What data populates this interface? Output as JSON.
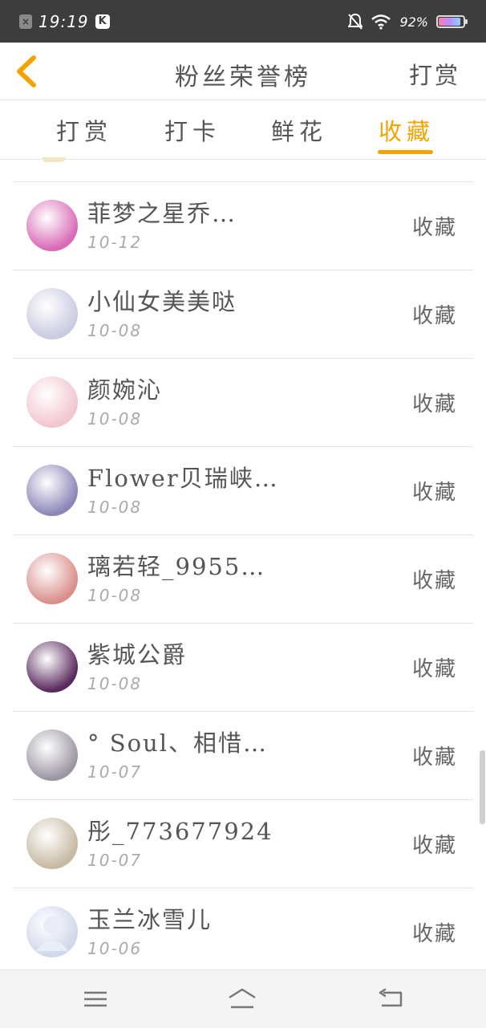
{
  "status_bar": {
    "time": "19:19",
    "battery_percent": "92%",
    "battery_level": 0.92,
    "left_icons": [
      "sim-x-icon",
      "k-app-icon"
    ],
    "right_icons": [
      "mute-icon",
      "wifi-icon",
      "battery-icon"
    ]
  },
  "header": {
    "title": "粉丝荣誉榜",
    "action_label": "打赏",
    "back_icon": "chevron-left-icon",
    "accent_color": "#f5a300"
  },
  "tabs": [
    {
      "label": "打赏",
      "active": false
    },
    {
      "label": "打卡",
      "active": false
    },
    {
      "label": "鲜花",
      "active": false
    },
    {
      "label": "收藏",
      "active": true
    }
  ],
  "fans": [
    {
      "name": "菲梦之星乔…",
      "date": "10-12",
      "action": "收藏",
      "avatar_color": "#d86ab6"
    },
    {
      "name": "小仙女美美哒",
      "date": "10-08",
      "action": "收藏",
      "avatar_color": "#c9cbe0"
    },
    {
      "name": "颜婉沁",
      "date": "10-08",
      "action": "收藏",
      "avatar_color": "#f2c6cf"
    },
    {
      "name": "Flower贝瑞峡…",
      "date": "10-08",
      "action": "收藏",
      "avatar_color": "#8b86b8"
    },
    {
      "name": "璃若轻_9955…",
      "date": "10-08",
      "action": "收藏",
      "avatar_color": "#d98e8a"
    },
    {
      "name": "紫城公爵",
      "date": "10-08",
      "action": "收藏",
      "avatar_color": "#5a2a5e"
    },
    {
      "name": "° Soul、相惜…",
      "date": "10-07",
      "action": "收藏",
      "avatar_color": "#9c95a3"
    },
    {
      "name": "彤_773677924",
      "date": "10-07",
      "action": "收藏",
      "avatar_color": "#c7b9a2"
    },
    {
      "name": "玉兰冰雪儿",
      "date": "10-06",
      "action": "收藏",
      "avatar_color": "#cfd7ea"
    }
  ],
  "nav_bar": {
    "icons": [
      "menu-icon",
      "home-icon",
      "back-icon"
    ]
  }
}
